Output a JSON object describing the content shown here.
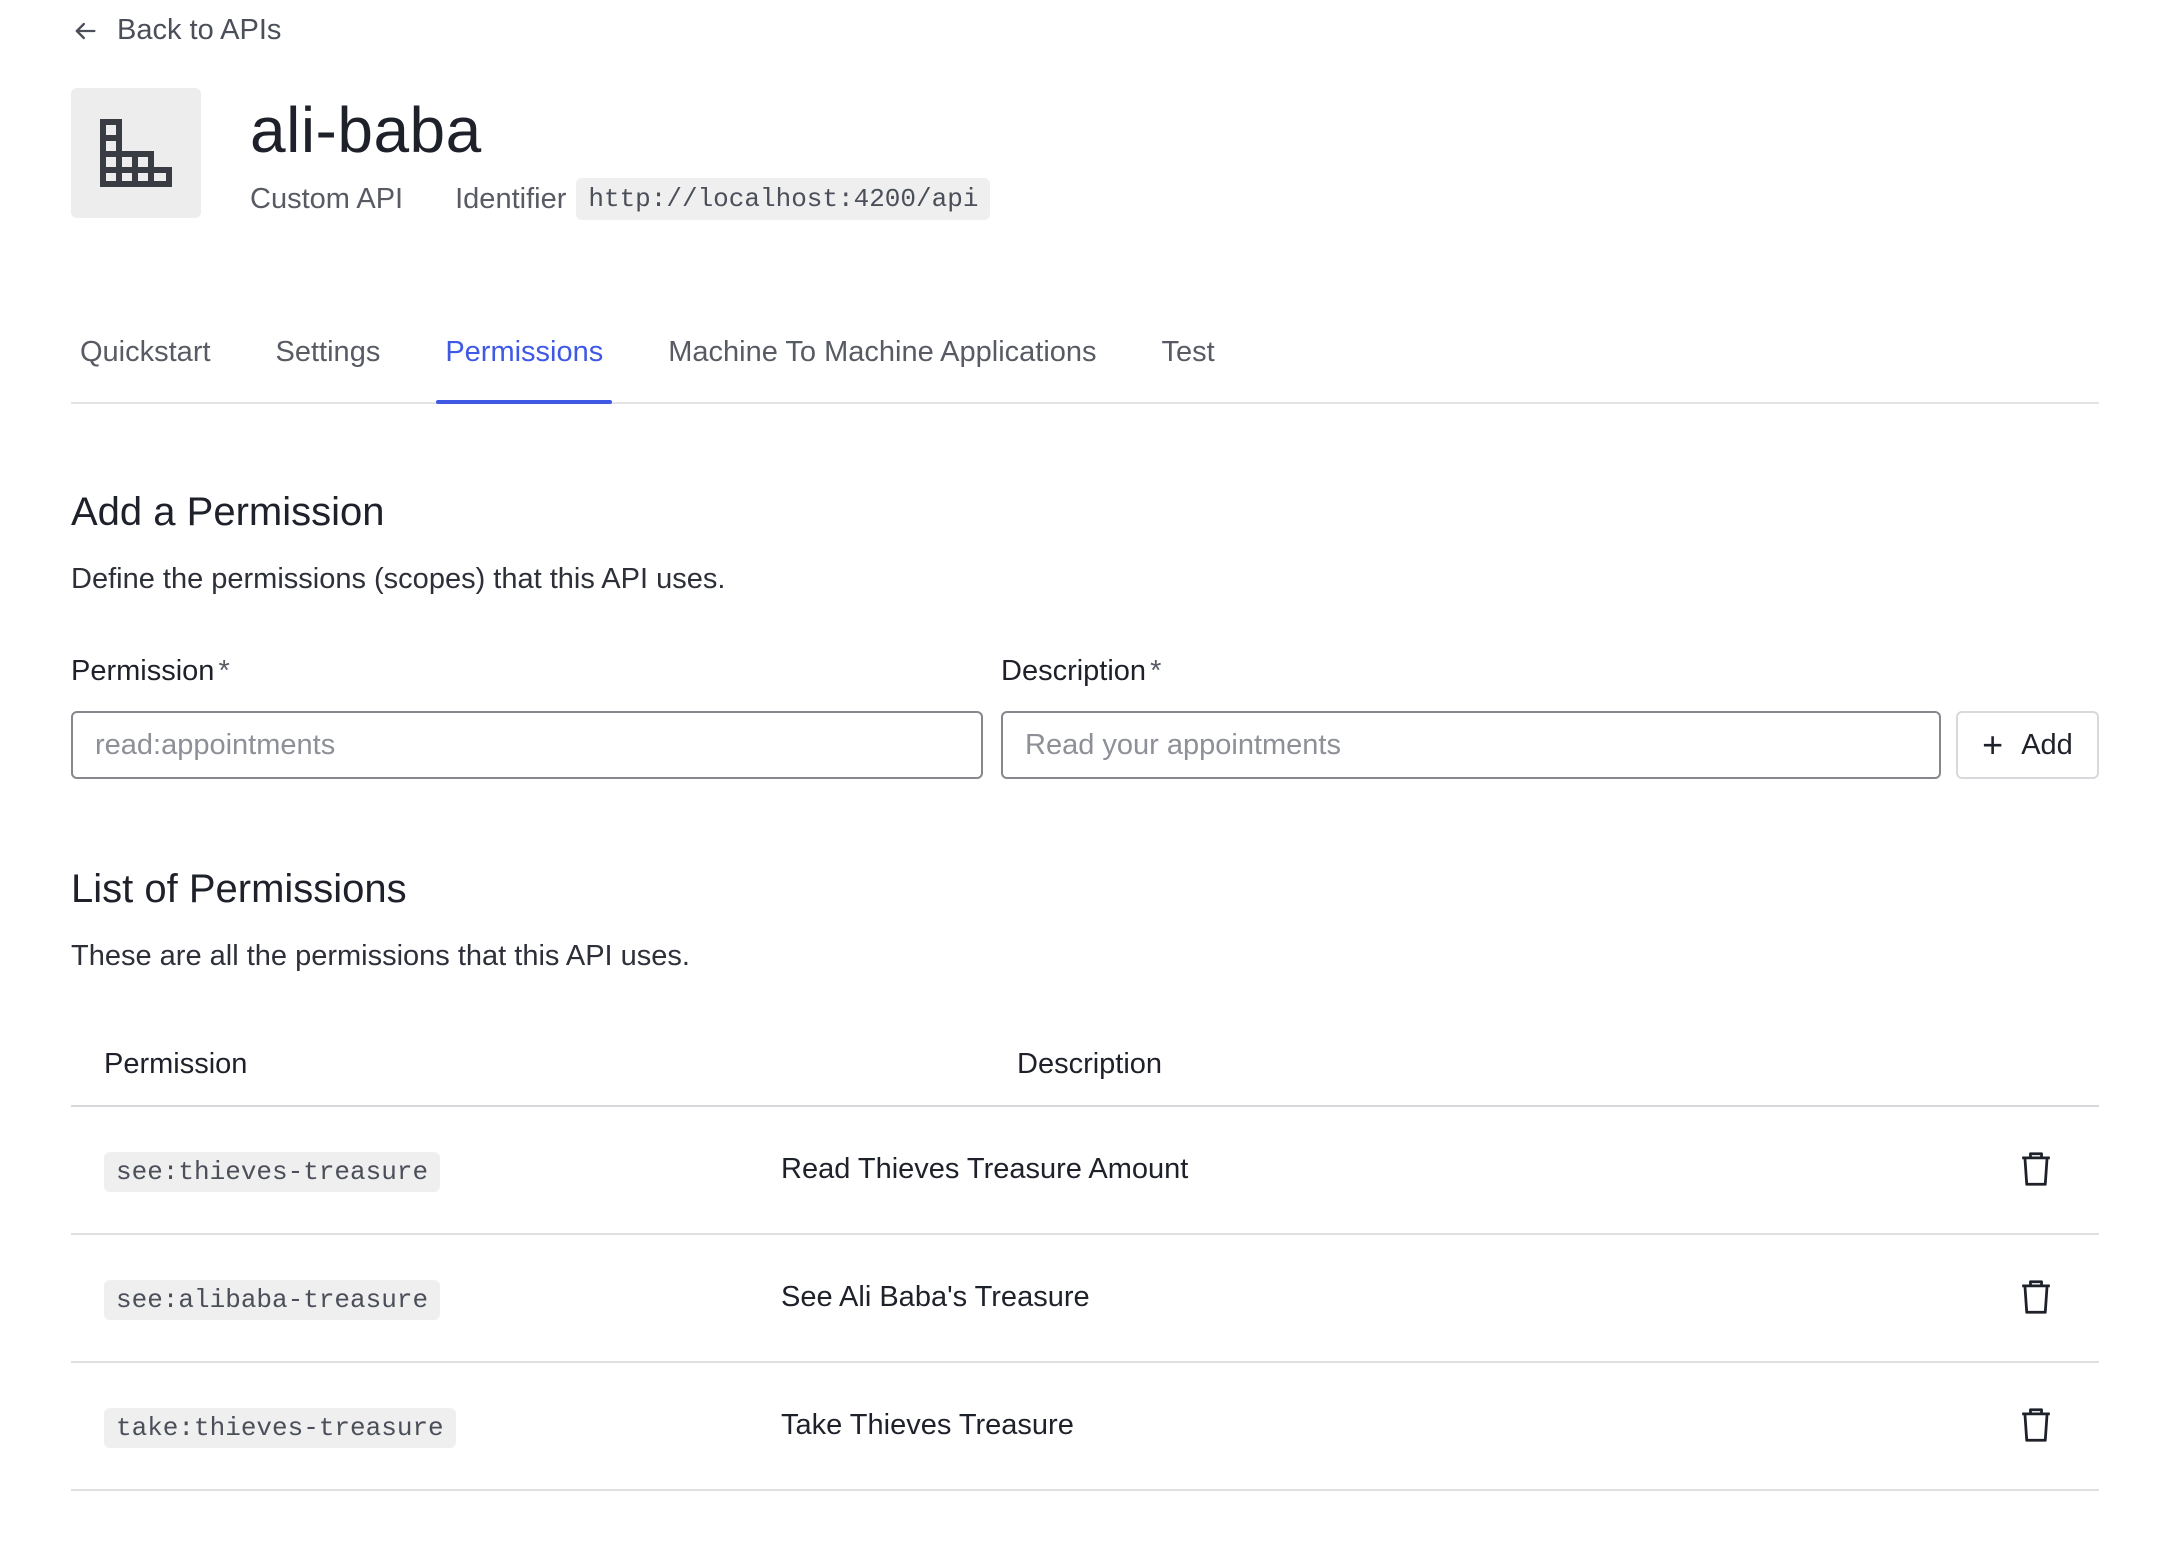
{
  "nav": {
    "back_label": "Back to APIs"
  },
  "api": {
    "name": "ali-baba",
    "type": "Custom API",
    "identifier_label": "Identifier",
    "identifier": "http://localhost:4200/api"
  },
  "tabs": [
    {
      "label": "Quickstart",
      "active": false
    },
    {
      "label": "Settings",
      "active": false
    },
    {
      "label": "Permissions",
      "active": true
    },
    {
      "label": "Machine To Machine Applications",
      "active": false
    },
    {
      "label": "Test",
      "active": false
    }
  ],
  "add_section": {
    "title": "Add a Permission",
    "description": "Define the permissions (scopes) that this API uses.",
    "permission_label": "Permission",
    "description_label": "Description",
    "required_mark": "*",
    "permission_placeholder": "read:appointments",
    "description_placeholder": "Read your appointments",
    "add_button": "Add"
  },
  "list_section": {
    "title": "List of Permissions",
    "description": "These are all the permissions that this API uses.",
    "columns": [
      "Permission",
      "Description"
    ],
    "rows": [
      {
        "permission": "see:thieves-treasure",
        "description": "Read Thieves Treasure Amount"
      },
      {
        "permission": "see:alibaba-treasure",
        "description": "See Ali Baba's Treasure"
      },
      {
        "permission": "take:thieves-treasure",
        "description": "Take Thieves Treasure"
      }
    ]
  },
  "icons": {
    "back": "arrow-left-icon",
    "api": "building-blocks-icon",
    "add": "plus-icon",
    "delete": "trash-icon"
  },
  "colors": {
    "accent": "#3f59e4"
  }
}
